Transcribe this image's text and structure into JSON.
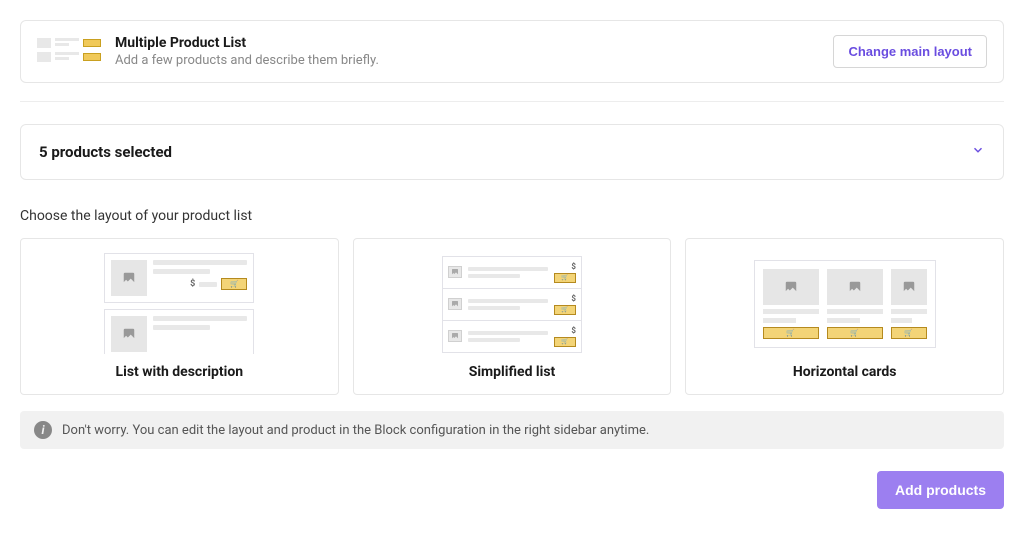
{
  "header": {
    "title": "Multiple Product List",
    "description": "Add a few products and describe them briefly.",
    "change_button": "Change main layout"
  },
  "accordion": {
    "title": "5 products selected"
  },
  "section_label": "Choose the layout of your product list",
  "layouts": [
    {
      "name": "List with description"
    },
    {
      "name": "Simplified list"
    },
    {
      "name": "Horizontal cards"
    }
  ],
  "info_text": "Don't worry. You can edit the layout and product in the Block configuration in the right sidebar anytime.",
  "footer": {
    "add_button": "Add products"
  },
  "icons": {
    "price": "$"
  }
}
